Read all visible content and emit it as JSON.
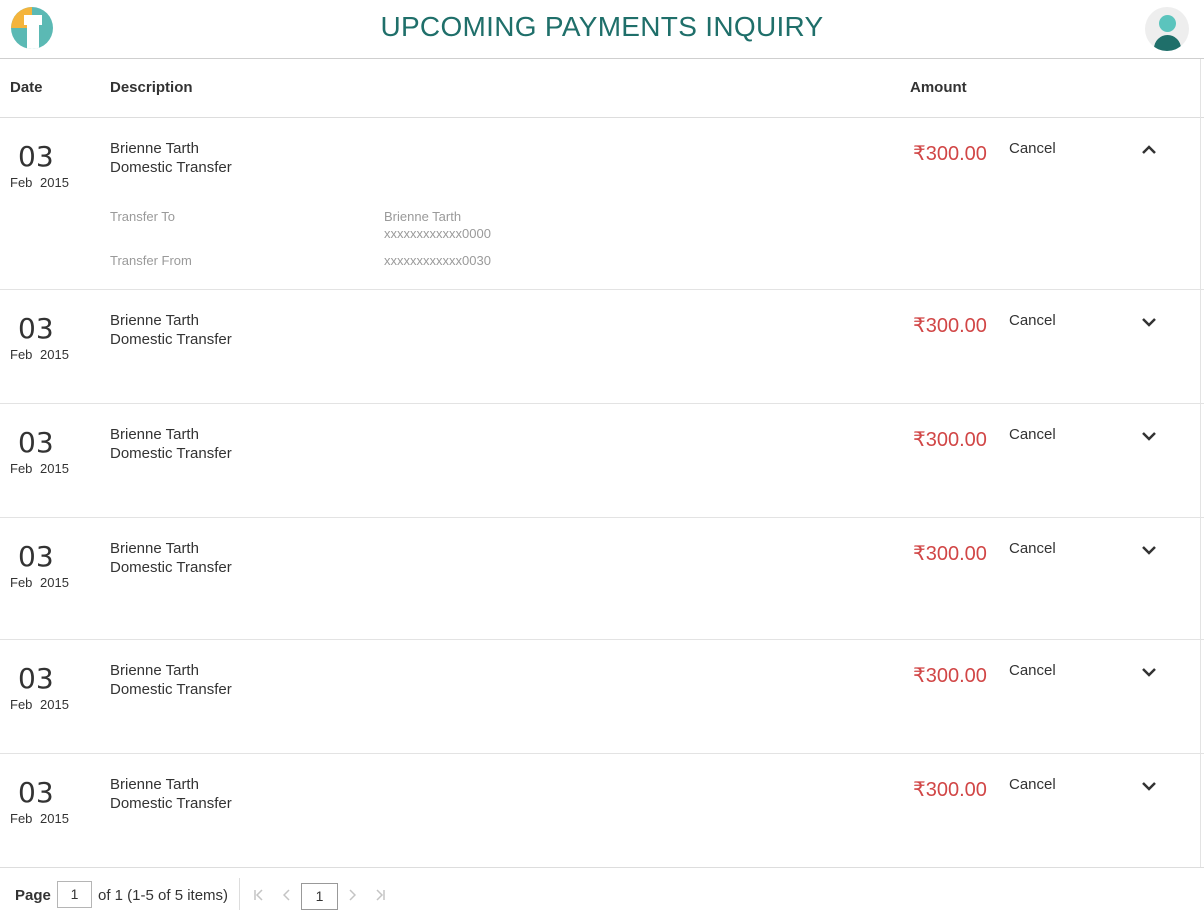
{
  "header": {
    "title": "UPCOMING PAYMENTS INQUIRY",
    "logo_icon": "bank-logo-icon",
    "avatar_icon": "user-avatar-icon"
  },
  "columns": {
    "date": "Date",
    "description": "Description",
    "amount": "Amount"
  },
  "rows": [
    {
      "day": "03",
      "month": "Feb",
      "year": "2015",
      "name": "Brienne Tarth",
      "type": "Domestic Transfer",
      "amount": "₹300.00",
      "action": "Cancel",
      "expanded": true,
      "details": {
        "transfer_to_label": "Transfer To",
        "transfer_to_name": "Brienne Tarth",
        "transfer_to_account": "xxxxxxxxxxxx0000",
        "transfer_from_label": "Transfer From",
        "transfer_from_account": "xxxxxxxxxxxx0030"
      }
    },
    {
      "day": "03",
      "month": "Feb",
      "year": "2015",
      "name": "Brienne Tarth",
      "type": "Domestic Transfer",
      "amount": "₹300.00",
      "action": "Cancel",
      "expanded": false
    },
    {
      "day": "03",
      "month": "Feb",
      "year": "2015",
      "name": "Brienne Tarth",
      "type": "Domestic Transfer",
      "amount": "₹300.00",
      "action": "Cancel",
      "expanded": false
    },
    {
      "day": "03",
      "month": "Feb",
      "year": "2015",
      "name": "Brienne Tarth",
      "type": "Domestic Transfer",
      "amount": "₹300.00",
      "action": "Cancel",
      "expanded": false
    },
    {
      "day": "03",
      "month": "Feb",
      "year": "2015",
      "name": "Brienne Tarth",
      "type": "Domestic Transfer",
      "amount": "₹300.00",
      "action": "Cancel",
      "expanded": false
    },
    {
      "day": "03",
      "month": "Feb",
      "year": "2015",
      "name": "Brienne Tarth",
      "type": "Domestic Transfer",
      "amount": "₹300.00",
      "action": "Cancel",
      "expanded": false
    }
  ],
  "pager": {
    "label": "Page",
    "page_input": "1",
    "of_text": "of 1 (1-5 of 5 items)",
    "current_page": "1",
    "first_icon": "K",
    "prev_icon": "‹",
    "next_icon": "›",
    "last_icon": "K"
  },
  "colors": {
    "title": "#1f6f6a",
    "amount": "#d14646",
    "muted": "#9a9a9a"
  }
}
